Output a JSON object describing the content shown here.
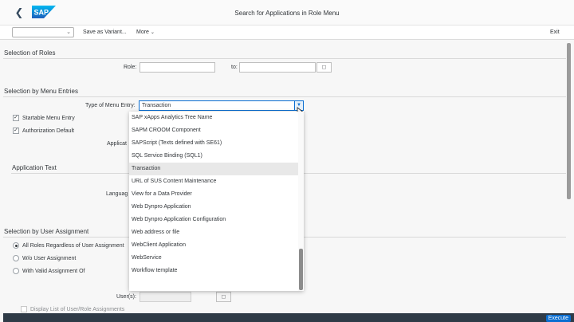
{
  "shell": {
    "title": "Search for Applications in Role Menu",
    "logo_text": "SAP"
  },
  "toolbar": {
    "variant_value": "",
    "save_variant_label": "Save as Variant...",
    "more_label": "More",
    "exit_label": "Exit"
  },
  "roles": {
    "heading": "Selection of Roles",
    "role_label": "Role:",
    "role_value": "",
    "to_label": "to:",
    "to_value": ""
  },
  "menu": {
    "heading": "Selection by Menu Entries",
    "type_label": "Type of Menu Entry:",
    "type_value": "Transaction",
    "startable_label": "Startable Menu Entry",
    "startable_checked": true,
    "auth_default_label": "Authorization Default",
    "auth_default_checked": true,
    "application_label": "Applicat",
    "options": [
      "SAP xApps Analytics Tree Name",
      "SAPM CROOM Component",
      "SAPScript (Texts defined with SE61)",
      "SQL Service Binding (SQL1)",
      "Transaction",
      "URL of SUS Content Maintenance",
      "View for a Data Provider",
      "Web Dynpro Application",
      "Web Dynpro Application Configuration",
      "Web address or file",
      "WebClient Application",
      "WebService",
      "Workflow template"
    ],
    "selected_option": "Transaction"
  },
  "app_text": {
    "heading": "Application Text",
    "language_label": "Languag"
  },
  "user_assign": {
    "heading": "Selection by User Assignment",
    "radios": [
      {
        "label": "All Roles Regardless of User Assignment",
        "selected": true
      },
      {
        "label": "W/o User Assignment",
        "selected": false
      },
      {
        "label": "With Valid Assignment Of",
        "selected": false
      }
    ],
    "users_label": "User(s):",
    "display_list_label": "Display List of User/Role Assignments"
  },
  "footer": {
    "execute_label": "Execute"
  },
  "colors": {
    "accent": "#0a6ed1",
    "shell_bg": "#fafafa",
    "footer_bg": "#2f3b47",
    "sap_blue": "#008fd3"
  },
  "icons": {
    "back": "chevron-left-icon",
    "value_help": "value-help-icon",
    "dropdown": "chevron-down-icon"
  }
}
